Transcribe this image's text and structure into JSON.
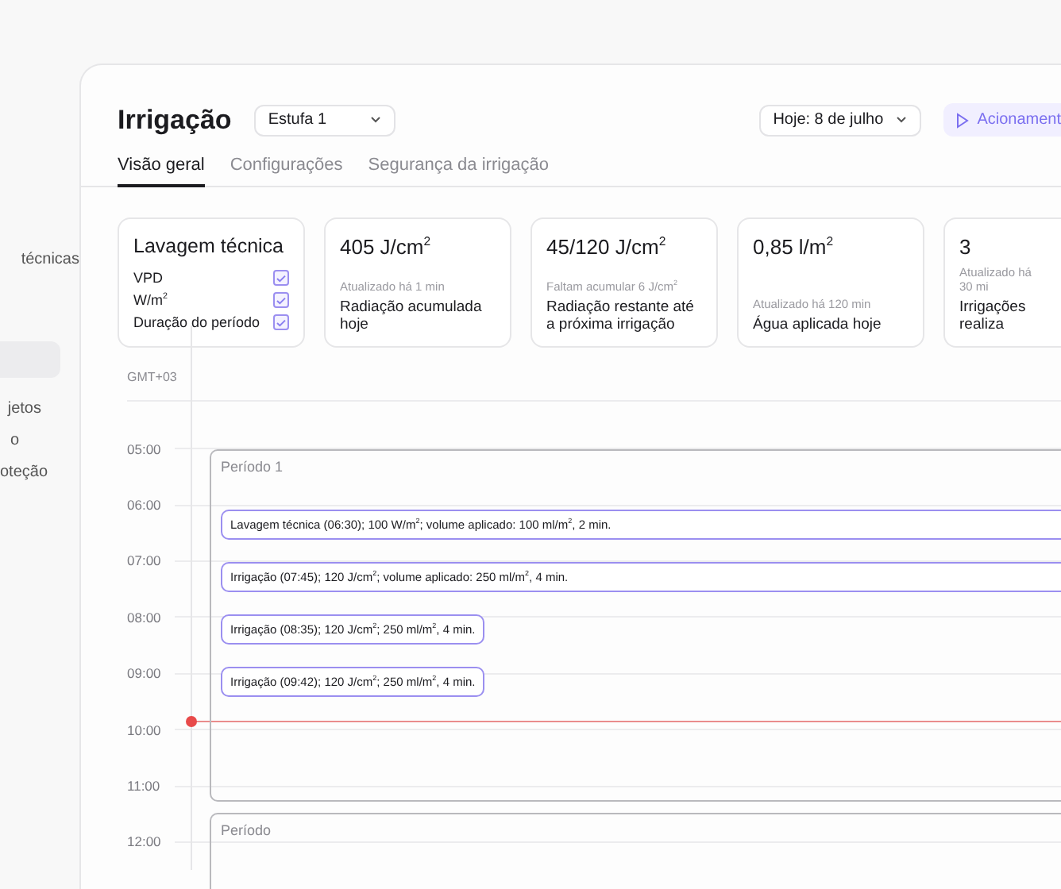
{
  "sidebar": {
    "items": [
      {
        "label": "técnicas",
        "selected": false
      },
      {
        "label": "jetos",
        "selected": false
      },
      {
        "label": "o",
        "selected": false
      },
      {
        "label": "oteção",
        "selected": false
      }
    ]
  },
  "header": {
    "title": "Irrigação",
    "greenhouse_select": {
      "value": "Estufa 1"
    },
    "date_select": {
      "value": "Hoje: 8 de julho"
    },
    "action_button": {
      "label": "Acionament"
    }
  },
  "tabs": [
    {
      "label": "Visão geral",
      "selected": true
    },
    {
      "label": "Configurações",
      "selected": false
    },
    {
      "label": "Segurança da irrigação",
      "selected": false
    }
  ],
  "cards": [
    {
      "kind": "checklist",
      "title": "Lavagem técnica",
      "items": [
        {
          "label": "VPD",
          "checked": true
        },
        {
          "label": "W/m$^{2}$",
          "checked": true
        },
        {
          "label": "Duração do período",
          "checked": true
        }
      ]
    },
    {
      "kind": "metric",
      "value": "405 J/cm$^{2}$",
      "note": "Atualizado há 1 min",
      "caption": "Radiação acumulada hoje"
    },
    {
      "kind": "metric",
      "value": "45/120 J/cm$^{2}$",
      "note": "Faltam acumular 6 J/cm$^{2}$",
      "caption": "Radiação restante até a próxima irrigação"
    },
    {
      "kind": "metric",
      "value": "0,85 l/m$^{2}$",
      "note": "Atualizado há 120 min",
      "caption": "Água aplicada hoje"
    },
    {
      "kind": "metric",
      "value": "3",
      "note": "Atualizado há 30 mi",
      "caption": "Irrigações realiza"
    }
  ],
  "timeline": {
    "timezone": "GMT+03",
    "hours": [
      "05:00",
      "06:00",
      "07:00",
      "08:00",
      "09:00",
      "10:00",
      "11:00",
      "12:00"
    ],
    "periods": [
      {
        "label": "Período 1",
        "events": [
          {
            "text": "Lavagem técnica (06:30); 100 W/m$^{2}$; volume aplicado: 100 ml/m$^{2}$, 2 min.",
            "full_width": true
          },
          {
            "text": "Irrigação (07:45); 120 J/cm$^{2}$; volume aplicado: 250 ml/m$^{2}$, 4 min.",
            "full_width": true
          },
          {
            "text": "Irrigação (08:35); 120 J/cm$^{2}$; 250 ml/m$^{2}$, 4 min.",
            "full_width": false
          },
          {
            "text": "Irrigação (09:42); 120 J/cm$^{2}$; 250 ml/m$^{2}$, 4 min.",
            "full_width": false
          }
        ]
      },
      {
        "label": "Período"
      }
    ]
  }
}
